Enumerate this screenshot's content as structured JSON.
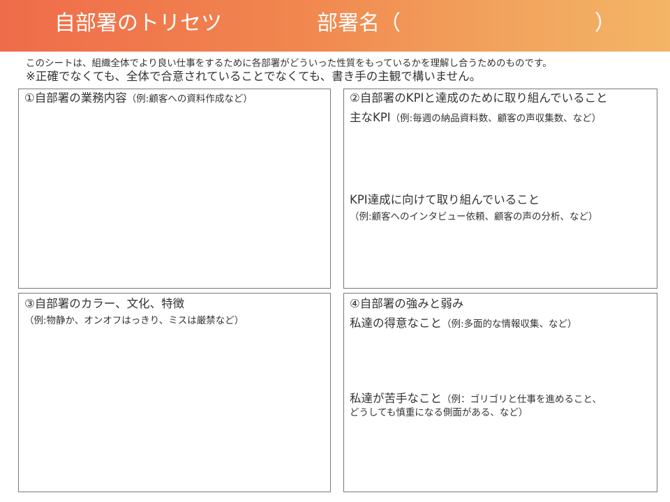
{
  "header": {
    "title": "自部署のトリセツ",
    "dept_label": "部署名（",
    "dept_close": "）"
  },
  "intro": {
    "line1": "このシートは、組織全体でより良い仕事をするために各部署がどういった性質をもっているかを理解し合うためのものです。",
    "line2": "※正確でなくても、全体で合意されていることでなくても、書き手の主観で構いません。"
  },
  "box1": {
    "title": "①自部署の業務内容",
    "example": "（例:顧客への資料作成など）"
  },
  "box2": {
    "title": "②自部署のKPIと達成のために取り組んでいること",
    "kpi_label": "主なKPI",
    "kpi_example": "（例:毎週の納品資料数、顧客の声収集数、など）",
    "action_label": "KPI達成に向けて取り組んでいること",
    "action_example": "（例:顧客へのインタビュー依頼、顧客の声の分析、など）"
  },
  "box3": {
    "title": "③自部署のカラー、文化、特徴",
    "example": "（例:物静か、オンオフはっきり、ミスは厳禁など）"
  },
  "box4": {
    "title": "④自部署の強みと弱み",
    "strength_label": "私達の得意なこと",
    "strength_example": "（例:多面的な情報収集、など）",
    "weakness_label": "私達が苦手なこと",
    "weakness_example_line1": "（例：ゴリゴリと仕事を進めること、",
    "weakness_example_line2": "どうしても慎重になる側面がある、など）"
  },
  "colors": {
    "header_gradient_start": "#ef6c4a",
    "header_gradient_end": "#f3b566",
    "border": "#777777",
    "text": "#333333"
  }
}
